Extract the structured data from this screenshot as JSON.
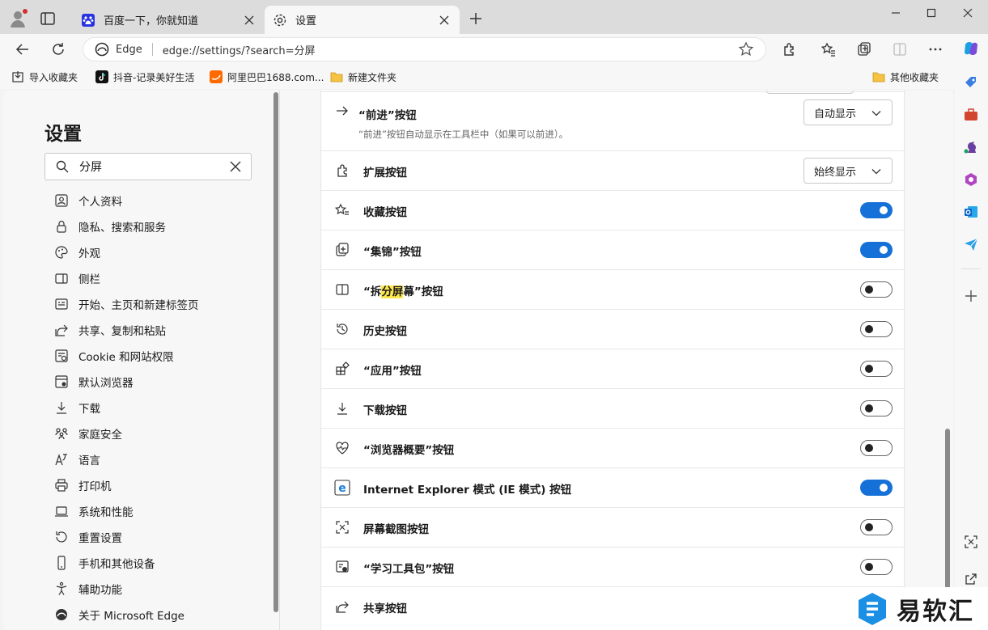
{
  "tabs": [
    {
      "title": "百度一下，你就知道",
      "icon": "baidu-icon"
    },
    {
      "title": "设置",
      "icon": "gear-icon"
    }
  ],
  "address": {
    "label": "Edge",
    "url": "edge://settings/?search=分屏"
  },
  "bookmarks": {
    "items": [
      {
        "label": "导入收藏夹",
        "icon": "import-icon"
      },
      {
        "label": "抖音-记录美好生活",
        "icon": "douyin-icon"
      },
      {
        "label": "阿里巴巴1688.com...",
        "icon": "alibaba-icon"
      },
      {
        "label": "新建文件夹",
        "icon": "folder-icon"
      }
    ],
    "other": "其他收藏夹"
  },
  "settings": {
    "title": "设置",
    "search_value": "分屏",
    "nav": [
      {
        "label": "个人资料",
        "icon": "profile-icon"
      },
      {
        "label": "隐私、搜索和服务",
        "icon": "lock-icon"
      },
      {
        "label": "外观",
        "icon": "palette-icon"
      },
      {
        "label": "侧栏",
        "icon": "sidebar-icon"
      },
      {
        "label": "开始、主页和新建标签页",
        "icon": "home-icon"
      },
      {
        "label": "共享、复制和粘贴",
        "icon": "share-icon"
      },
      {
        "label": "Cookie 和网站权限",
        "icon": "cookie-icon"
      },
      {
        "label": "默认浏览器",
        "icon": "browser-icon"
      },
      {
        "label": "下载",
        "icon": "download-icon"
      },
      {
        "label": "家庭安全",
        "icon": "family-icon"
      },
      {
        "label": "语言",
        "icon": "language-icon"
      },
      {
        "label": "打印机",
        "icon": "printer-icon"
      },
      {
        "label": "系统和性能",
        "icon": "system-icon"
      },
      {
        "label": "重置设置",
        "icon": "reset-icon"
      },
      {
        "label": "手机和其他设备",
        "icon": "phone-icon"
      },
      {
        "label": "辅助功能",
        "icon": "accessibility-icon"
      },
      {
        "label": "关于 Microsoft Edge",
        "icon": "edge-icon"
      }
    ]
  },
  "rows": {
    "forward": {
      "label": "“前进”按钮",
      "desc": "“前进”按钮自动显示在工具栏中（如果可以前进）。",
      "value": "自动显示"
    },
    "extensions": {
      "label": "扩展按钮",
      "value": "始终显示"
    },
    "favorites": {
      "label": "收藏按钮",
      "on": true
    },
    "collections": {
      "label": "“集锦”按钮",
      "on": true
    },
    "split": {
      "label_pre": "“拆",
      "label_hl": "分屏",
      "label_post": "幕”按钮",
      "on": false
    },
    "history": {
      "label": "历史按钮",
      "on": false
    },
    "apps": {
      "label": "“应用”按钮",
      "on": false
    },
    "downloads": {
      "label": "下载按钮",
      "on": false
    },
    "essentials": {
      "label": "“浏览器概要”按钮",
      "on": false
    },
    "ie": {
      "label": "Internet Explorer 模式 (IE 模式) 按钮",
      "on": true
    },
    "screenshot": {
      "label": "屏幕截图按钮",
      "on": false
    },
    "learning": {
      "label": "“学习工具包”按钮",
      "on": false
    },
    "share": {
      "label": "共享按钮"
    }
  },
  "watermark": {
    "text": "易软汇"
  },
  "colors": {
    "accent": "#1570d8",
    "highlight": "#ffe84a"
  }
}
